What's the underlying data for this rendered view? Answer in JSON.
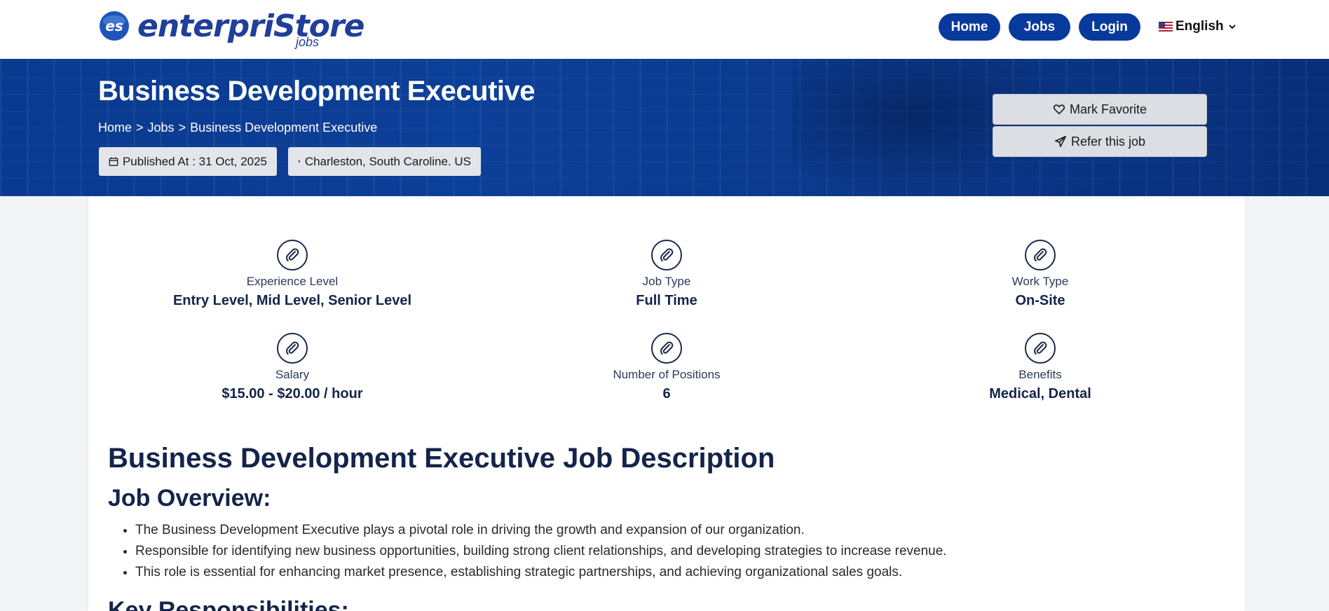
{
  "brand": {
    "logo_text": "enterpriStore",
    "logo_sub": "jobs"
  },
  "nav": {
    "home": "Home",
    "jobs": "Jobs",
    "login": "Login",
    "language": "English"
  },
  "hero": {
    "title": "Business Development Executive",
    "breadcrumb": [
      "Home",
      ">",
      "Jobs",
      ">",
      "Business Development Executive"
    ],
    "published": "Published At : 31 Oct, 2025",
    "location": "Charleston, South Caroline. US",
    "favorite_label": "Mark Favorite",
    "refer_label": "Refer this job"
  },
  "attributes": [
    {
      "label": "Experience Level",
      "value": "Entry Level, Mid Level, Senior Level",
      "icon": "paperclip-icon"
    },
    {
      "label": "Job Type",
      "value": "Full Time",
      "icon": "paperclip-icon"
    },
    {
      "label": "Work Type",
      "value": "On-Site",
      "icon": "paperclip-icon"
    },
    {
      "label": "Salary",
      "value": "$15.00 - $20.00 / hour",
      "icon": "paperclip-icon"
    },
    {
      "label": "Number of Positions",
      "value": "6",
      "icon": "paperclip-icon"
    },
    {
      "label": "Benefits",
      "value": "Medical, Dental",
      "icon": "paperclip-icon"
    }
  ],
  "description": {
    "heading": "Business Development Executive Job Description",
    "overview_heading": "Job Overview:",
    "overview_items": [
      "The Business Development Executive plays a pivotal role in driving the growth and expansion of our organization.",
      "Responsible for identifying new business opportunities, building strong client relationships, and developing strategies to increase revenue.",
      "This role is essential for enhancing market presence, establishing strategic partnerships, and achieving organizational sales goals."
    ],
    "responsibilities_heading": "Key Responsibilities:"
  },
  "colors": {
    "primary": "#08399c",
    "hero": "#0c3f98",
    "text": "#14244a"
  }
}
